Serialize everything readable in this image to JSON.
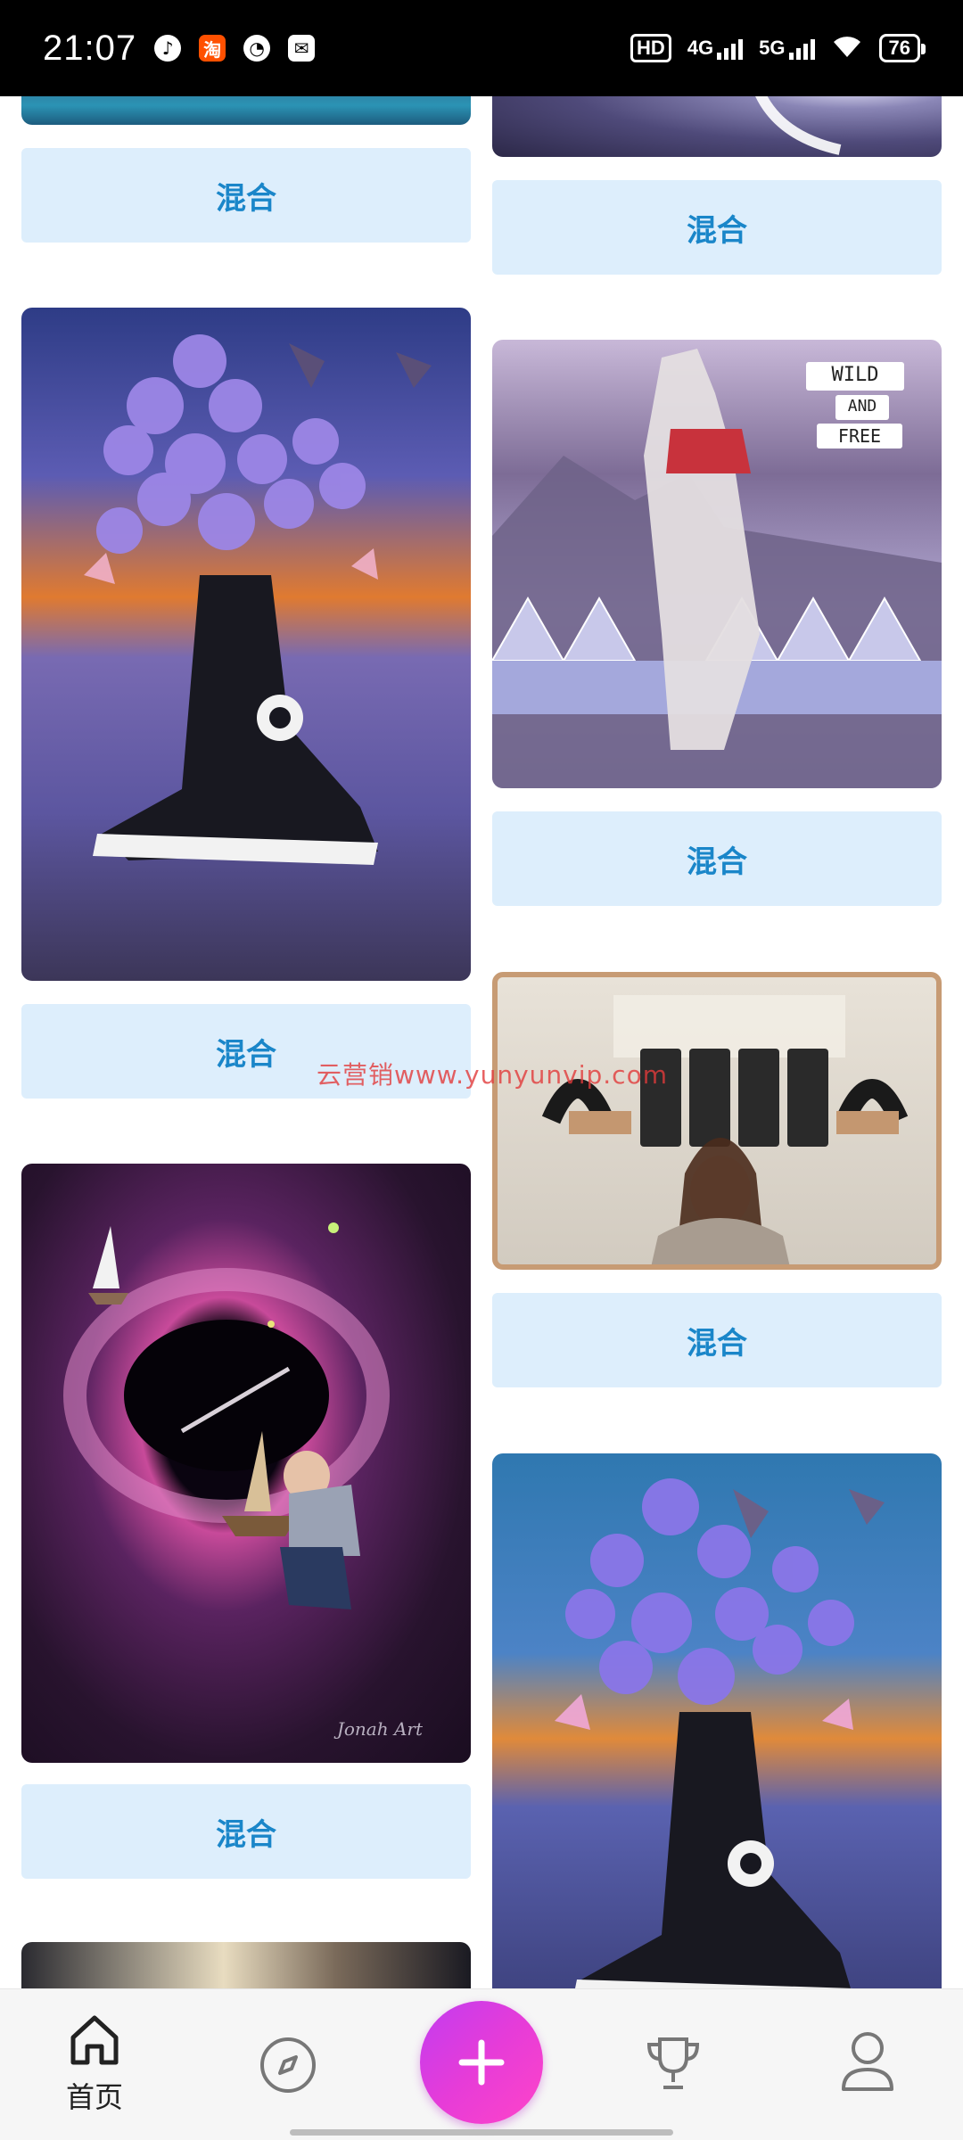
{
  "status_bar": {
    "time": "21:07",
    "app_icons": [
      "music-icon",
      "taobao-icon",
      "speed-icon",
      "message-icon"
    ],
    "hd_label": "HD",
    "net1": "4G",
    "net2": "5G",
    "battery": "76"
  },
  "feed": {
    "blend_label": "混合",
    "cards": [
      {
        "image": "ocean-waves",
        "button": "混合"
      },
      {
        "image": "purple-nebula-moon",
        "button": "混合"
      },
      {
        "image": "sneaker-flowers-collage",
        "button": "混合"
      },
      {
        "image": "wild-and-free-collage",
        "button": "混合"
      },
      {
        "image": "girl-telephones-collage",
        "button": "混合"
      },
      {
        "image": "boy-black-hole-boat",
        "button": "混合"
      },
      {
        "image": "sneaker-flowers-blue",
        "button": null
      },
      {
        "image": "partial-image",
        "button": null
      }
    ],
    "wild_text": [
      "WILD",
      "AND",
      "FREE"
    ],
    "signature": "Jonah Art"
  },
  "watermark": "云营销www.yunyunvip.com",
  "bottom_nav": {
    "items": [
      {
        "icon": "home-icon",
        "label": "首页",
        "active": true
      },
      {
        "icon": "compass-icon",
        "label": ""
      },
      {
        "icon": "plus-icon",
        "label": ""
      },
      {
        "icon": "trophy-icon",
        "label": ""
      },
      {
        "icon": "profile-icon",
        "label": ""
      }
    ]
  },
  "colors": {
    "button_bg": "#ddeefc",
    "button_text": "#1a86c9",
    "fab_gradient_start": "#c23cf0",
    "fab_gradient_end": "#ff44c8"
  }
}
